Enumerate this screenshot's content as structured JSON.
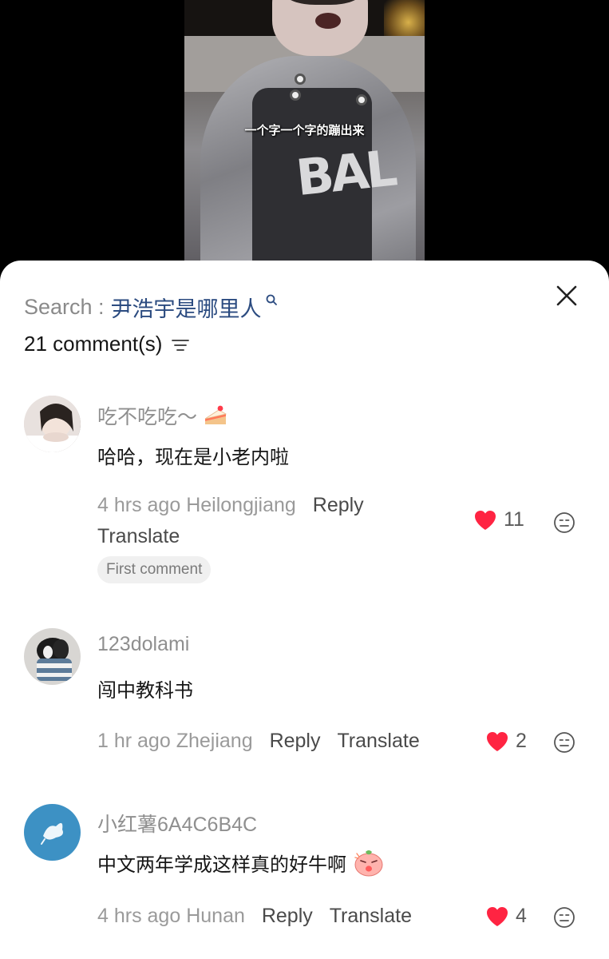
{
  "video": {
    "subtitle": "一个字一个字的蹦出来"
  },
  "sheet": {
    "search_prefix": "Search :",
    "search_query": "尹浩宇是哪里人",
    "comment_count": "21 comment(s)",
    "icons": {
      "close": "close-icon",
      "sort": "sort-icon",
      "search": "search-icon"
    }
  },
  "comments": [
    {
      "username": "吃不吃吃～",
      "text": "哈哈，现在是小老内啦",
      "time": "4 hrs ago",
      "location": "Heilongjiang",
      "reply_label": "Reply",
      "translate_label": "Translate",
      "badge": "First comment",
      "likes": "11"
    },
    {
      "username": "123dolami",
      "text": "闯中教科书",
      "time": "1 hr ago",
      "location": "Zhejiang",
      "reply_label": "Reply",
      "translate_label": "Translate",
      "likes": "2"
    },
    {
      "username": "小红薯6A4C6B4C",
      "text": "中文两年学成这样真的好牛啊",
      "time": "4 hrs ago",
      "location": "Hunan",
      "reply_label": "Reply",
      "translate_label": "Translate",
      "likes": "4"
    }
  ],
  "colors": {
    "heart": "#ff2442",
    "query": "#2b4b80",
    "muted": "#8f8f8f"
  }
}
